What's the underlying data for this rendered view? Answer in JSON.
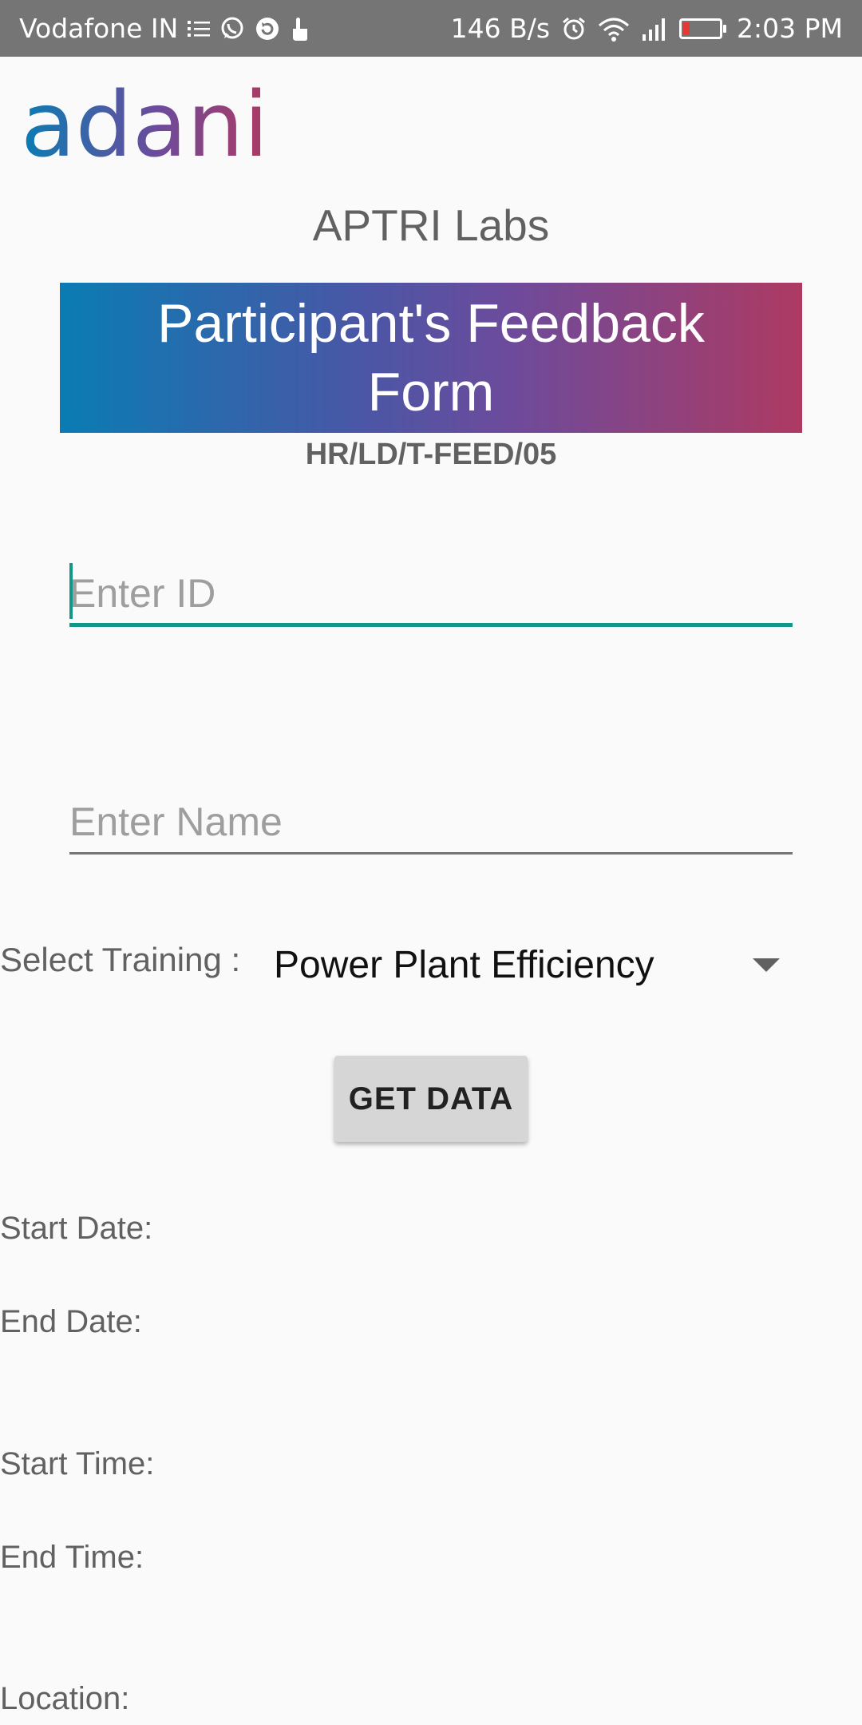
{
  "status_bar": {
    "carrier": "Vodafone IN",
    "speed": "146 B/s",
    "time": "2:03 PM",
    "icons": [
      "list-icon",
      "whatsapp-icon",
      "sync-icon",
      "touch-icon",
      "alarm-icon",
      "wifi-icon",
      "signal-icon",
      "battery-icon"
    ]
  },
  "logo": {
    "text": "adani",
    "colors": [
      "#0a7cb3",
      "#6c4b9c",
      "#ad3a62"
    ]
  },
  "header": {
    "subtitle": "APTRI Labs",
    "title": "Participant's Feedback Form",
    "form_code": "HR/LD/T-FEED/05"
  },
  "form": {
    "id_field": {
      "placeholder": "Enter ID",
      "value": ""
    },
    "name_field": {
      "placeholder": "Enter Name",
      "value": ""
    },
    "training_select": {
      "label": "Select Training :",
      "selected": "Power Plant Efficiency"
    },
    "get_data_button": "GET DATA"
  },
  "details": {
    "start_date_label": "Start Date:",
    "end_date_label": "End Date:",
    "start_time_label": "Start Time:",
    "end_time_label": "End Time:",
    "location_label": "Location:"
  },
  "colors": {
    "accent": "#129688",
    "status_bar": "#757575",
    "button": "#d6d6d6"
  }
}
